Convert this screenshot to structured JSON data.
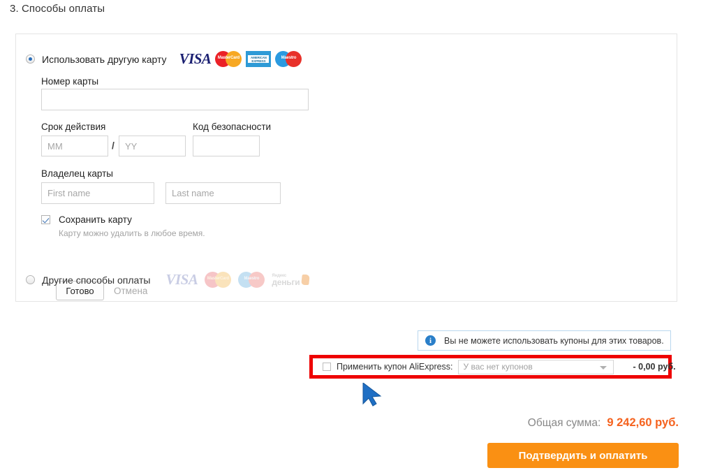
{
  "page": {
    "section_title": "3. Способы оплаты"
  },
  "payment_panel": {
    "option_new_card": {
      "label": "Использовать другую карту",
      "selected": true,
      "logos": [
        {
          "name": "visa-logo",
          "text": "VISA"
        },
        {
          "name": "mastercard-logo",
          "text": "MasterCard"
        },
        {
          "name": "amex-logo",
          "line1": "AMERICAN",
          "line2": "EXPRESS"
        },
        {
          "name": "maestro-logo",
          "text": "Maestro"
        }
      ]
    },
    "card_number": {
      "label": "Номер карты",
      "value": "",
      "placeholder": ""
    },
    "expiry": {
      "label": "Срок действия",
      "month_placeholder": "MM",
      "month_value": "",
      "separator": "/",
      "year_placeholder": "YY",
      "year_value": ""
    },
    "security_code": {
      "label": "Код безопасности",
      "value": "",
      "placeholder": ""
    },
    "card_holder": {
      "label": "Владелец карты",
      "first_name_placeholder": "First name",
      "first_name_value": "",
      "last_name_placeholder": "Last name",
      "last_name_value": ""
    },
    "save_card": {
      "label": "Сохранить карту",
      "checked": true,
      "hint": "Карту можно удалить в любое время."
    },
    "actions": {
      "done_label": "Готово",
      "cancel_label": "Отмена"
    },
    "option_other": {
      "label": "Другие способы оплаты",
      "selected": false,
      "logos": [
        {
          "name": "visa-logo",
          "text": "VISA"
        },
        {
          "name": "mastercard-logo",
          "text": "MasterCard"
        },
        {
          "name": "maestro-logo",
          "text": "Maestro"
        },
        {
          "name": "yandex-money-logo",
          "small": "Яндекс",
          "big": "деньги"
        }
      ]
    }
  },
  "notice": {
    "icon": "info-icon",
    "text": "Вы не можете использовать купоны для этих товаров."
  },
  "coupon": {
    "checked": false,
    "label": "Применить купон AliExpress:",
    "select_value": "У вас нет купонов",
    "amount": "- 0,00 руб.",
    "highlight_color": "#ee0000"
  },
  "summary": {
    "total_label": "Общая сумма:",
    "total_value": "9 242,60 руб.",
    "total_color": "#f5621e",
    "pay_button_label": "Подтвердить и оплатить",
    "pay_button_color": "#fa9013"
  }
}
